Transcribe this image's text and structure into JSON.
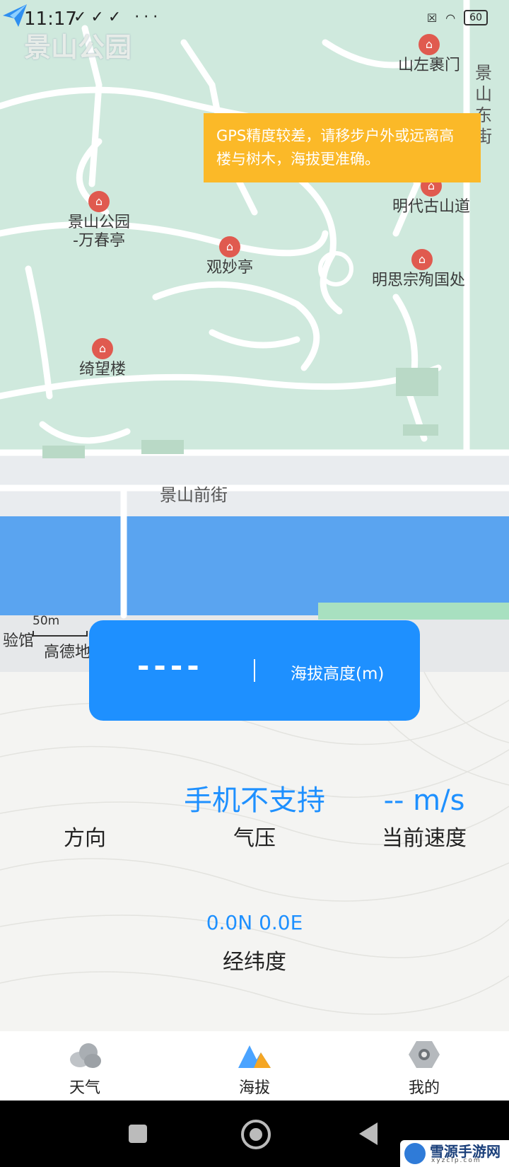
{
  "status_bar": {
    "time": "11:17",
    "left_icons": "✓✓✓ ···",
    "battery": "60"
  },
  "map": {
    "area_name": "景山公园",
    "pois": [
      {
        "name": "景山公园\n-万春亭"
      },
      {
        "name": "观妙亭"
      },
      {
        "name": "绮望楼"
      },
      {
        "name": "明代古山道"
      },
      {
        "name": "明思宗殉国处"
      },
      {
        "name": "山左裹门"
      }
    ],
    "road_label": "景山前街",
    "side_label": "景山东街",
    "scale": "50m",
    "amap_text": "高德地",
    "edge_text": "验馆"
  },
  "gps_warning": "GPS精度较差，请移步户外或远离高楼与树木，海拔更准确。",
  "altitude": {
    "value": "----",
    "label": "海拔高度(m)"
  },
  "stats": {
    "direction": {
      "value": "",
      "label": "方向"
    },
    "pressure": {
      "value": "手机不支持",
      "label": "气压"
    },
    "speed": {
      "value": "-- m/s",
      "label": "当前速度"
    }
  },
  "coordinates": {
    "value": "0.0N 0.0E",
    "label": "经纬度"
  },
  "tabs": [
    {
      "label": "天气",
      "icon": "cloud-icon"
    },
    {
      "label": "海拔",
      "icon": "mountain-icon"
    },
    {
      "label": "我的",
      "icon": "hexagon-icon"
    }
  ],
  "watermark": {
    "title": "雪源手游网",
    "sub": "xyzclp.com"
  },
  "colors": {
    "accent": "#1e90ff",
    "warning": "#fbb928",
    "map_green": "#cfe9dd",
    "water": "#5aa4f0"
  }
}
